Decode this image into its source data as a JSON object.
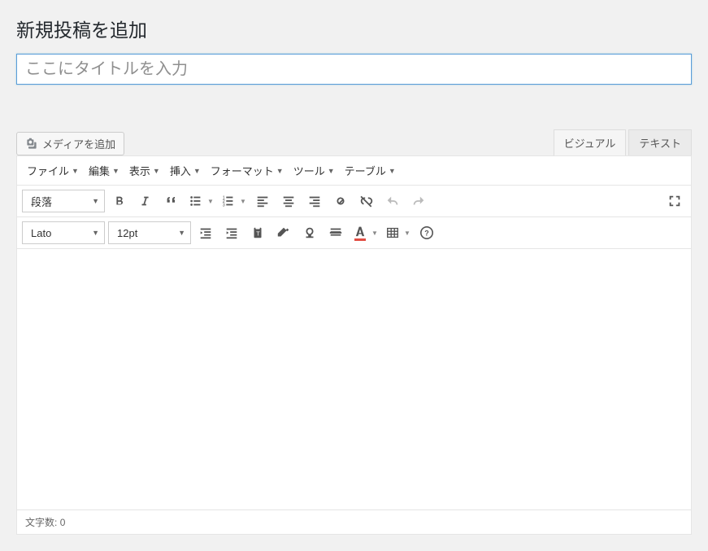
{
  "page": {
    "title": "新規投稿を追加"
  },
  "titleInput": {
    "placeholder": "ここにタイトルを入力",
    "value": ""
  },
  "addMedia": {
    "label": "メディアを追加"
  },
  "tabs": {
    "visual": "ビジュアル",
    "text": "テキスト"
  },
  "menubar": {
    "file": "ファイル",
    "edit": "編集",
    "view": "表示",
    "insert": "挿入",
    "format": "フォーマット",
    "tools": "ツール",
    "table": "テーブル"
  },
  "toolbar1": {
    "paragraph": "段落"
  },
  "toolbar2": {
    "font": "Lato",
    "fontSize": "12pt",
    "textColor": "#e14d43"
  },
  "statusBar": {
    "wordCountLabel": "文字数:",
    "wordCount": "0"
  }
}
